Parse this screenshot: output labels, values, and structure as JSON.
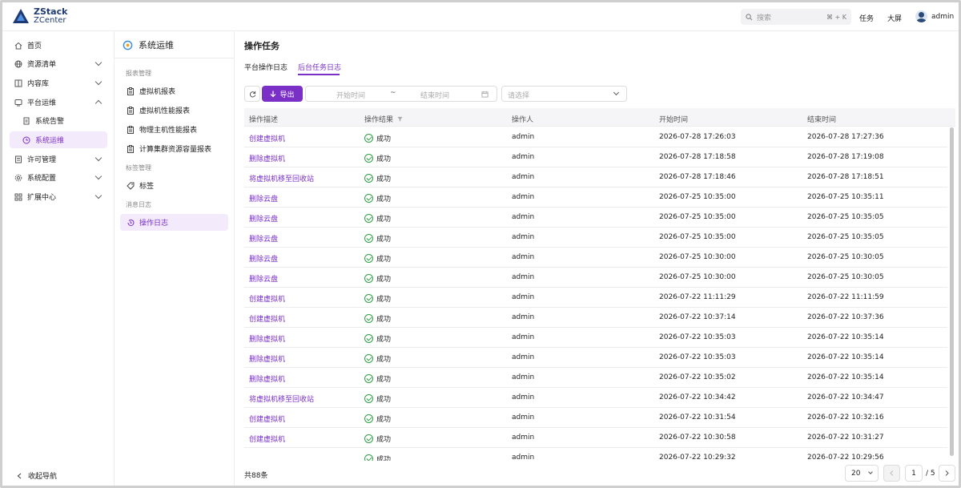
{
  "brand": {
    "line1": "ZStack",
    "line2": "ZCenter"
  },
  "topbar": {
    "search_placeholder": "搜索",
    "shortcut": "⌘ + K",
    "tasks": "任务",
    "bigscreen": "大屏",
    "user": "admin"
  },
  "nav": {
    "items": [
      {
        "label": "首页",
        "icon": "home-icon"
      },
      {
        "label": "资源清单",
        "icon": "globe-icon",
        "chevron": "down"
      },
      {
        "label": "内容库",
        "icon": "library-icon",
        "chevron": "down"
      },
      {
        "label": "平台运维",
        "icon": "monitor-icon",
        "chevron": "up"
      },
      {
        "label": "系统告警",
        "icon": "alert-doc-icon",
        "sub": true
      },
      {
        "label": "系统运维",
        "icon": "clock-icon",
        "sub": true,
        "active": true
      },
      {
        "label": "许可管理",
        "icon": "license-icon",
        "chevron": "down"
      },
      {
        "label": "系统配置",
        "icon": "gear-icon",
        "chevron": "down"
      },
      {
        "label": "扩展中心",
        "icon": "grid-icon",
        "chevron": "down"
      }
    ],
    "collapse": "收起导航"
  },
  "subnav": {
    "title": "系统运维",
    "groups": [
      {
        "label": "报表管理"
      },
      {
        "label": "标签管理"
      },
      {
        "label": "消息日志"
      }
    ],
    "items": [
      {
        "label": "虚拟机报表"
      },
      {
        "label": "虚拟机性能报表"
      },
      {
        "label": "物理主机性能报表"
      },
      {
        "label": "计算集群资源容量报表"
      },
      {
        "label": "标签"
      },
      {
        "label": "操作日志",
        "active": true
      }
    ]
  },
  "page": {
    "title": "操作任务",
    "tabs": [
      {
        "label": "平台操作日志"
      },
      {
        "label": "后台任务日志",
        "active": true
      }
    ]
  },
  "toolbar": {
    "export": "导出",
    "start_placeholder": "开始时间",
    "tilde": "~",
    "end_placeholder": "结束时间",
    "select_placeholder": "请选择"
  },
  "table": {
    "headers": [
      "操作描述",
      "操作结果",
      "操作人",
      "开始时间",
      "结束时间"
    ],
    "rows": [
      {
        "desc": "创建虚拟机",
        "result": "成功",
        "user": "admin",
        "start": "2026-07-28 17:26:03",
        "end": "2026-07-28 17:27:36"
      },
      {
        "desc": "删除虚拟机",
        "result": "成功",
        "user": "admin",
        "start": "2026-07-28 17:18:58",
        "end": "2026-07-28 17:19:08"
      },
      {
        "desc": "将虚拟机移至回收站",
        "result": "成功",
        "user": "admin",
        "start": "2026-07-28 17:18:46",
        "end": "2026-07-28 17:18:51"
      },
      {
        "desc": "删除云盘",
        "result": "成功",
        "user": "admin",
        "start": "2026-07-25 10:35:00",
        "end": "2026-07-25 10:35:11"
      },
      {
        "desc": "删除云盘",
        "result": "成功",
        "user": "admin",
        "start": "2026-07-25 10:35:00",
        "end": "2026-07-25 10:35:05"
      },
      {
        "desc": "删除云盘",
        "result": "成功",
        "user": "admin",
        "start": "2026-07-25 10:35:00",
        "end": "2026-07-25 10:35:05"
      },
      {
        "desc": "删除云盘",
        "result": "成功",
        "user": "admin",
        "start": "2026-07-25 10:30:00",
        "end": "2026-07-25 10:30:05"
      },
      {
        "desc": "删除云盘",
        "result": "成功",
        "user": "admin",
        "start": "2026-07-25 10:30:00",
        "end": "2026-07-25 10:30:05"
      },
      {
        "desc": "创建虚拟机",
        "result": "成功",
        "user": "admin",
        "start": "2026-07-22 11:11:29",
        "end": "2026-07-22 11:11:59"
      },
      {
        "desc": "创建虚拟机",
        "result": "成功",
        "user": "admin",
        "start": "2026-07-22 10:37:14",
        "end": "2026-07-22 10:37:36"
      },
      {
        "desc": "删除虚拟机",
        "result": "成功",
        "user": "admin",
        "start": "2026-07-22 10:35:03",
        "end": "2026-07-22 10:35:14"
      },
      {
        "desc": "删除虚拟机",
        "result": "成功",
        "user": "admin",
        "start": "2026-07-22 10:35:03",
        "end": "2026-07-22 10:35:14"
      },
      {
        "desc": "删除虚拟机",
        "result": "成功",
        "user": "admin",
        "start": "2026-07-22 10:35:02",
        "end": "2026-07-22 10:35:14"
      },
      {
        "desc": "将虚拟机移至回收站",
        "result": "成功",
        "user": "admin",
        "start": "2026-07-22 10:34:42",
        "end": "2026-07-22 10:34:47"
      },
      {
        "desc": "创建虚拟机",
        "result": "成功",
        "user": "admin",
        "start": "2026-07-22 10:31:54",
        "end": "2026-07-22 10:32:16"
      },
      {
        "desc": "创建虚拟机",
        "result": "成功",
        "user": "admin",
        "start": "2026-07-22 10:30:58",
        "end": "2026-07-22 10:31:27"
      },
      {
        "desc": "",
        "result": "成功",
        "user": "admin",
        "start": "2026-07-22 10:29:32",
        "end": "2026-07-22 10:29:56"
      }
    ]
  },
  "pagination": {
    "total": "共88条",
    "page_size": "20",
    "current": "1",
    "of": "/ 5"
  },
  "colors": {
    "accent": "#7a2fc7",
    "success": "#2f9e44",
    "brand": "#1f3a73"
  }
}
